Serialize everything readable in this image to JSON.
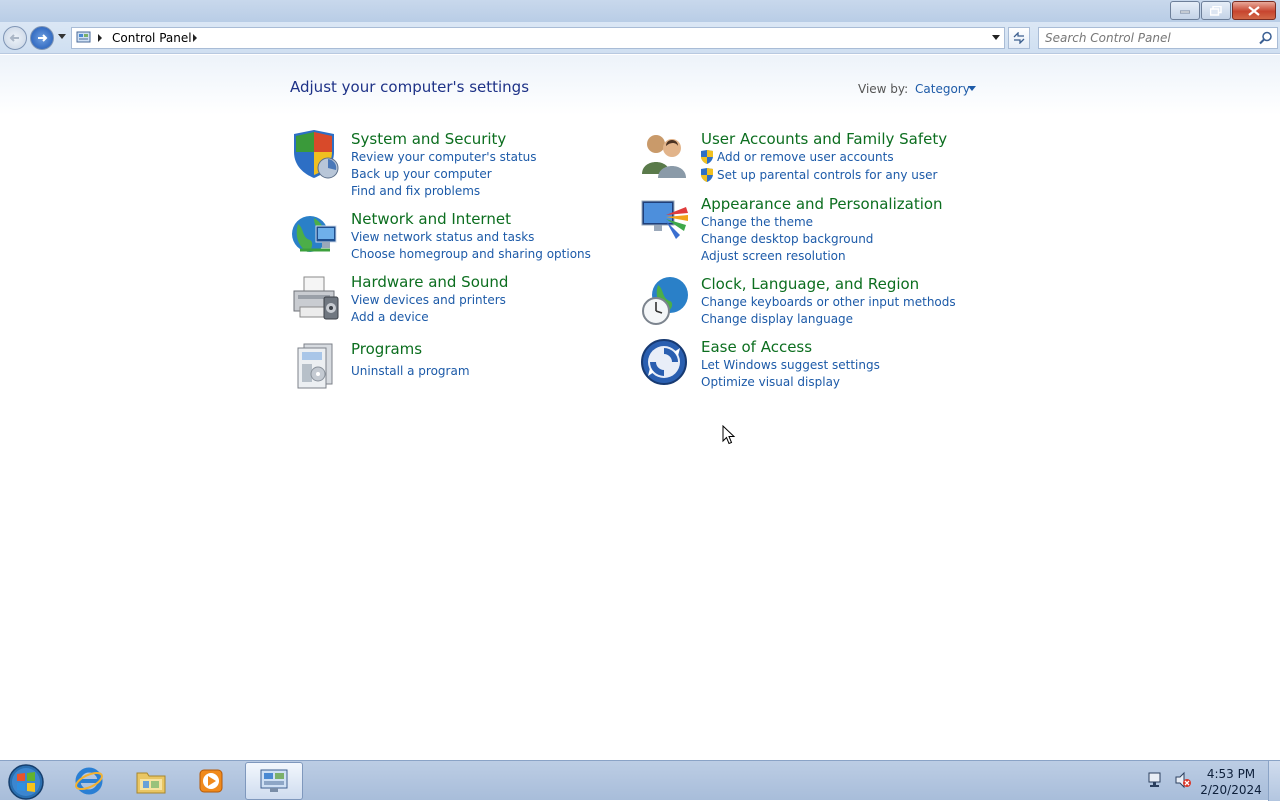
{
  "window": {
    "breadcrumb": "Control Panel",
    "search_placeholder": "Search Control Panel"
  },
  "content": {
    "heading": "Adjust your computer's settings",
    "view_by_label": "View by:",
    "view_by_value": "Category"
  },
  "categories": [
    {
      "title": "System and Security",
      "icon": "shield-icon",
      "links": [
        "Review your computer's status",
        "Back up your computer",
        "Find and fix problems"
      ]
    },
    {
      "title": "Network and Internet",
      "icon": "globe-network-icon",
      "links": [
        "View network status and tasks",
        "Choose homegroup and sharing options"
      ]
    },
    {
      "title": "Hardware and Sound",
      "icon": "printer-icon",
      "links": [
        "View devices and printers",
        "Add a device"
      ]
    },
    {
      "title": "Programs",
      "icon": "programs-icon",
      "links": [
        "Uninstall a program"
      ]
    },
    {
      "title": "User Accounts and Family Safety",
      "icon": "users-icon",
      "links": [
        "Add or remove user accounts",
        "Set up parental controls for any user"
      ]
    },
    {
      "title": "Appearance and Personalization",
      "icon": "appearance-icon",
      "links": [
        "Change the theme",
        "Change desktop background",
        "Adjust screen resolution"
      ]
    },
    {
      "title": "Clock, Language, and Region",
      "icon": "clock-globe-icon",
      "links": [
        "Change keyboards or other input methods",
        "Change display language"
      ]
    },
    {
      "title": "Ease of Access",
      "icon": "ease-of-access-icon",
      "links": [
        "Let Windows suggest settings",
        "Optimize visual display"
      ]
    }
  ],
  "taskbar": {
    "time": "4:53 PM",
    "date": "2/20/2024",
    "pinned": [
      "internet-explorer-icon",
      "explorer-folder-icon",
      "media-player-icon",
      "control-panel-icon"
    ]
  },
  "colors": {
    "category_title": "#0c6e1f",
    "link": "#1c5aa8",
    "heading": "#1e3287"
  }
}
